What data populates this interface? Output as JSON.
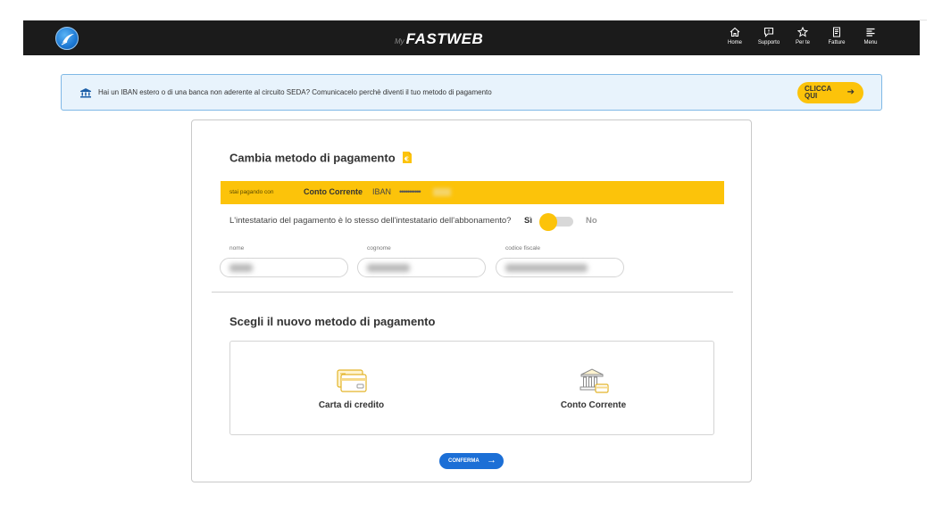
{
  "header": {
    "brand_prefix": "My",
    "brand_name": "FASTWEB",
    "nav": [
      {
        "label": "Home",
        "icon": "home-icon"
      },
      {
        "label": "Supporto",
        "icon": "chat-icon"
      },
      {
        "label": "Per te",
        "icon": "star-icon"
      },
      {
        "label": "Fatture",
        "icon": "invoice-icon"
      },
      {
        "label": "Menu",
        "icon": "menu-icon"
      }
    ]
  },
  "banner": {
    "text": "Hai un IBAN estero o di una banca non aderente al circuito SEDA? Comunicacelo perchè diventi il tuo metodo di pagamento",
    "button_label": "CLICCA QUI",
    "icon": "bank-icon"
  },
  "change": {
    "title": "Cambia metodo di pagamento",
    "paying_with_label": "stai pagando con",
    "current_method": "Conto Corrente",
    "iban_label": "IBAN",
    "iban_masked": "•••••••••••",
    "holder_question": "L'intestatario del pagamento è lo stesso dell'intestatario dell'abbonamento?",
    "yes_label": "Sì",
    "no_label": "No",
    "holder_same": true,
    "fields": [
      {
        "label": "nome",
        "value": ""
      },
      {
        "label": "cognome",
        "value": ""
      },
      {
        "label": "codice fiscale",
        "value": ""
      }
    ]
  },
  "new_method": {
    "title": "Scegli il nuovo metodo di pagamento",
    "options": [
      {
        "label": "Carta di credito",
        "icon": "credit-card-icon"
      },
      {
        "label": "Conto Corrente",
        "icon": "bank-account-icon"
      }
    ],
    "confirm_label": "CONFERMA"
  },
  "colors": {
    "accent_yellow": "#fcc30a",
    "primary_blue": "#1c6fd6",
    "navbar": "#1b1b1b",
    "banner_bg": "#e8f3fc"
  }
}
